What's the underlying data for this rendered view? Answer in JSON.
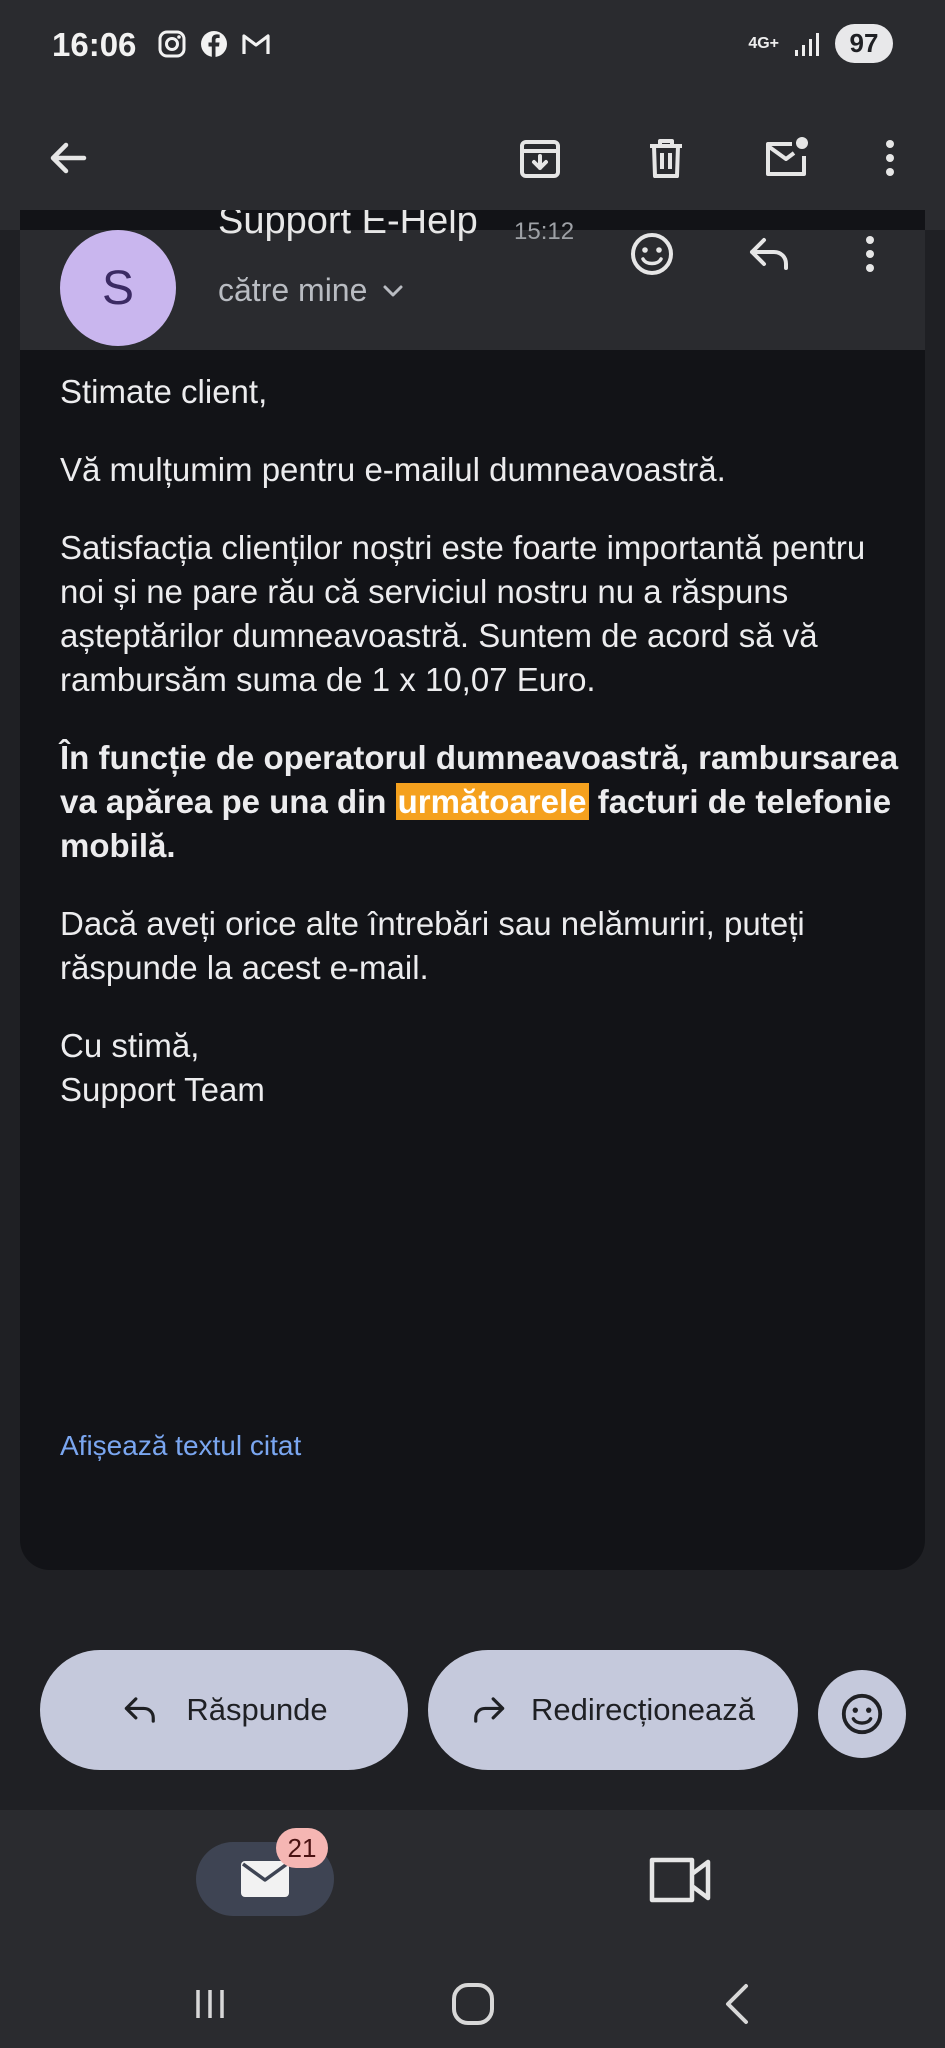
{
  "status": {
    "time": "16:06",
    "network": "4G+",
    "battery": "97"
  },
  "email": {
    "sender": "Support E-Help",
    "time": "15:12",
    "avatar_letter": "S",
    "recipient": "către mine",
    "body": {
      "greeting": "Stimate client,",
      "thanks": "Vă mulțumim pentru e-mailul dumneavoastră.",
      "satisfaction": "Satisfacția clienților noștri este foarte importantă pentru noi și ne pare rău că serviciul nostru nu a răspuns așteptărilor dumneavoastră. Suntem de acord să vă rambursăm suma de 1 x 10,07 Euro.",
      "refund_before": "În funcție de operatorul dumneavoastră, rambursarea va apărea pe una din ",
      "refund_highlight": "următoarele",
      "refund_after": " facturi de telefonie mobilă.",
      "questions": "Dacă aveți orice alte întrebări sau nelămuriri, puteți răspunde la acest e-mail.",
      "closing": "Cu stimă,",
      "signature": "Support Team"
    },
    "show_quoted": "Afișează textul citat"
  },
  "actions": {
    "reply": "Răspunde",
    "forward": "Redirecționează"
  },
  "nav": {
    "mail_badge": "21"
  },
  "colors": {
    "highlight": "#f5a11e",
    "link": "#7aa6f0",
    "pill": "#c5c9dc"
  }
}
